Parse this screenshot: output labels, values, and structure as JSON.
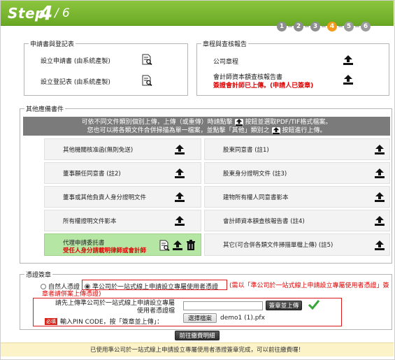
{
  "header": {
    "step_word": "Step",
    "current": "4",
    "separator": "/",
    "total": "6",
    "steps": [
      "1",
      "2",
      "3",
      "4",
      "5",
      "6"
    ],
    "active_step": 4
  },
  "app_section": {
    "legend": "申請書與登記表",
    "items": [
      {
        "label": "設立申請書 (由系統產製)",
        "icon": "document-search-icon"
      },
      {
        "label": "設立登記表 (由系統產製)",
        "icon": "document-search-icon"
      }
    ]
  },
  "charter_section": {
    "legend": "章程與查核報告",
    "items": [
      {
        "label": "公司章程",
        "icon": "upload-icon"
      },
      {
        "label": "會計師資本額查核報告書",
        "note": "簽證會計師已上傳。(申請人已簽章)",
        "icon": "upload-icon"
      }
    ]
  },
  "other_docs": {
    "legend": "其他應備書件",
    "banner_line1_a": "可依不同文件類別個別上傳，上傳（或重傳）時請點擊",
    "banner_line1_b": "按鈕並選取PDF/TIF格式檔案。",
    "banner_line2_a": "您也可以將各類文件合併掃描為單一檔案，並點擊「其他」類別之",
    "banner_line2_b": "按鈕進行上傳。",
    "cells": [
      {
        "label": "其他機關核准函(無則免送)"
      },
      {
        "label": "股東同意書 (註1)"
      },
      {
        "label": "董事願任同意書 (註2)"
      },
      {
        "label": "股東身分證明文件 (註3)"
      },
      {
        "label": "董事或其他負責人身分證明文件"
      },
      {
        "label": "建物所有權人同意書影本"
      },
      {
        "label": "所有權證明文件影本"
      },
      {
        "label": "會計師資本額查核報告書 (註4)"
      },
      {
        "label": "代理申請委託書",
        "note": "受任人身分請載明律師或會計師"
      },
      {
        "label": "其它(可合併各類文件掃描單檔上傳) (註5)"
      }
    ]
  },
  "signing": {
    "legend": "憑證簽章",
    "option_natural": "自然人憑證",
    "option_company": "準公司於一站式線上申請設立專屬使用者憑證",
    "note": "(需以「準公司於一站式線上申請設立專屬使用者憑證」簽章者請併案上傳憑證)",
    "upload_label_1": "請先上傳準公司於一站式線上申請設立專屬",
    "upload_label_2": "使用者憑證檔",
    "pin_required": "必填",
    "pin_label": "輸入PIN CODE，按「簽章並上傳」：",
    "sign_button": "簽章並上傳",
    "choose_file_button": "選擇檔案",
    "file_name": "demo1 (1).pfx",
    "proceed_button": "前往繳費明細"
  },
  "footer": {
    "message": "已使用準公司於一站式線上申請設立專屬使用者憑證簽章完成，可以前往繳費囉！"
  },
  "colors": {
    "header_green": "#7ab82e",
    "active_step": "#f39a1c",
    "alert_red": "#e00000",
    "agent_cell_green": "#b6e6a4",
    "footer_yellow": "#fcf3c9"
  }
}
